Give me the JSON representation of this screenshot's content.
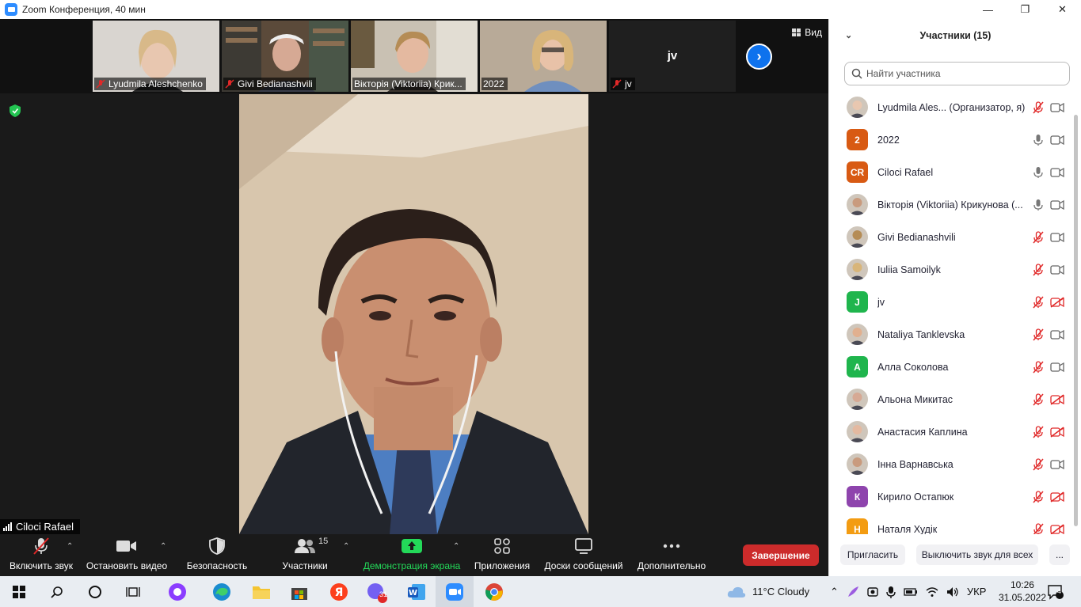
{
  "window": {
    "title": "Zoom Конференция, 40 мин",
    "controls": [
      "minimize",
      "restore",
      "close"
    ]
  },
  "gallery": {
    "view_label": "Вид",
    "thumbs": [
      {
        "name": "Lyudmila Aleshchenko",
        "muted": true
      },
      {
        "name": "Givi Bedianashvili",
        "muted": true
      },
      {
        "name": "Вікторія (Viktoriia) Крик...",
        "muted": false
      },
      {
        "name": "2022",
        "muted": false
      },
      {
        "name": "jv",
        "muted": true
      }
    ],
    "jv_center_name": "jv"
  },
  "active_speaker": {
    "name": "Ciloci Rafael"
  },
  "toolbar": {
    "unmute": "Включить звук",
    "stop_video": "Остановить видео",
    "security": "Безопасность",
    "participants": "Участники",
    "participants_count": "15",
    "share": "Демонстрация экрана",
    "apps": "Приложения",
    "whiteboards": "Доски сообщений",
    "more": "Дополнительно",
    "end": "Завершение",
    "colors": {
      "end": "#cc2b2b",
      "share": "#23d959",
      "accent": "#0e72ed"
    }
  },
  "panel": {
    "title": "Участники (15)",
    "search_placeholder": "Найти участника",
    "participants": [
      {
        "name": "Lyudmila Ales... (Организатор, я)",
        "avatar": "photo",
        "mic": "muted",
        "cam": "on"
      },
      {
        "name": "2022",
        "avatar": "2",
        "avatar_color": "#d85a13",
        "mic": "on",
        "cam": "on"
      },
      {
        "name": "Ciloci Rafael",
        "avatar": "CR",
        "avatar_color": "#d85a13",
        "mic": "on",
        "cam": "on"
      },
      {
        "name": "Вікторія (Viktoriia) Крикунова (...",
        "avatar": "photo",
        "mic": "on",
        "cam": "on"
      },
      {
        "name": "Givi Bedianashvili",
        "avatar": "photo",
        "mic": "muted",
        "cam": "on"
      },
      {
        "name": "Iuliia Samoilyk",
        "avatar": "photo",
        "mic": "muted",
        "cam": "on"
      },
      {
        "name": "jv",
        "avatar": "J",
        "avatar_color": "#1fb54d",
        "mic": "muted",
        "cam": "off"
      },
      {
        "name": "Nataliya Tanklevska",
        "avatar": "photo",
        "mic": "muted",
        "cam": "on"
      },
      {
        "name": "Алла Соколова",
        "avatar": "А",
        "avatar_color": "#1fb54d",
        "mic": "muted",
        "cam": "on"
      },
      {
        "name": "Альона Микитас",
        "avatar": "photo",
        "mic": "muted",
        "cam": "off"
      },
      {
        "name": "Анастасия Каплина",
        "avatar": "photo",
        "mic": "muted",
        "cam": "off"
      },
      {
        "name": "Інна Варнавська",
        "avatar": "photo",
        "mic": "muted",
        "cam": "on"
      },
      {
        "name": "Кирило Остапюк",
        "avatar": "К",
        "avatar_color": "#8e44ad",
        "mic": "muted",
        "cam": "off"
      },
      {
        "name": "Наталя Худік",
        "avatar": "Н",
        "avatar_color": "#f39c12",
        "mic": "muted",
        "cam": "off"
      }
    ],
    "invite": "Пригласить",
    "mute_all": "Выключить звук для всех",
    "more": "..."
  },
  "taskbar": {
    "weather": "11°C  Cloudy",
    "lang": "УКР",
    "time": "10:26",
    "date": "31.05.2022",
    "notifications": "4",
    "viber_badge": "31"
  }
}
